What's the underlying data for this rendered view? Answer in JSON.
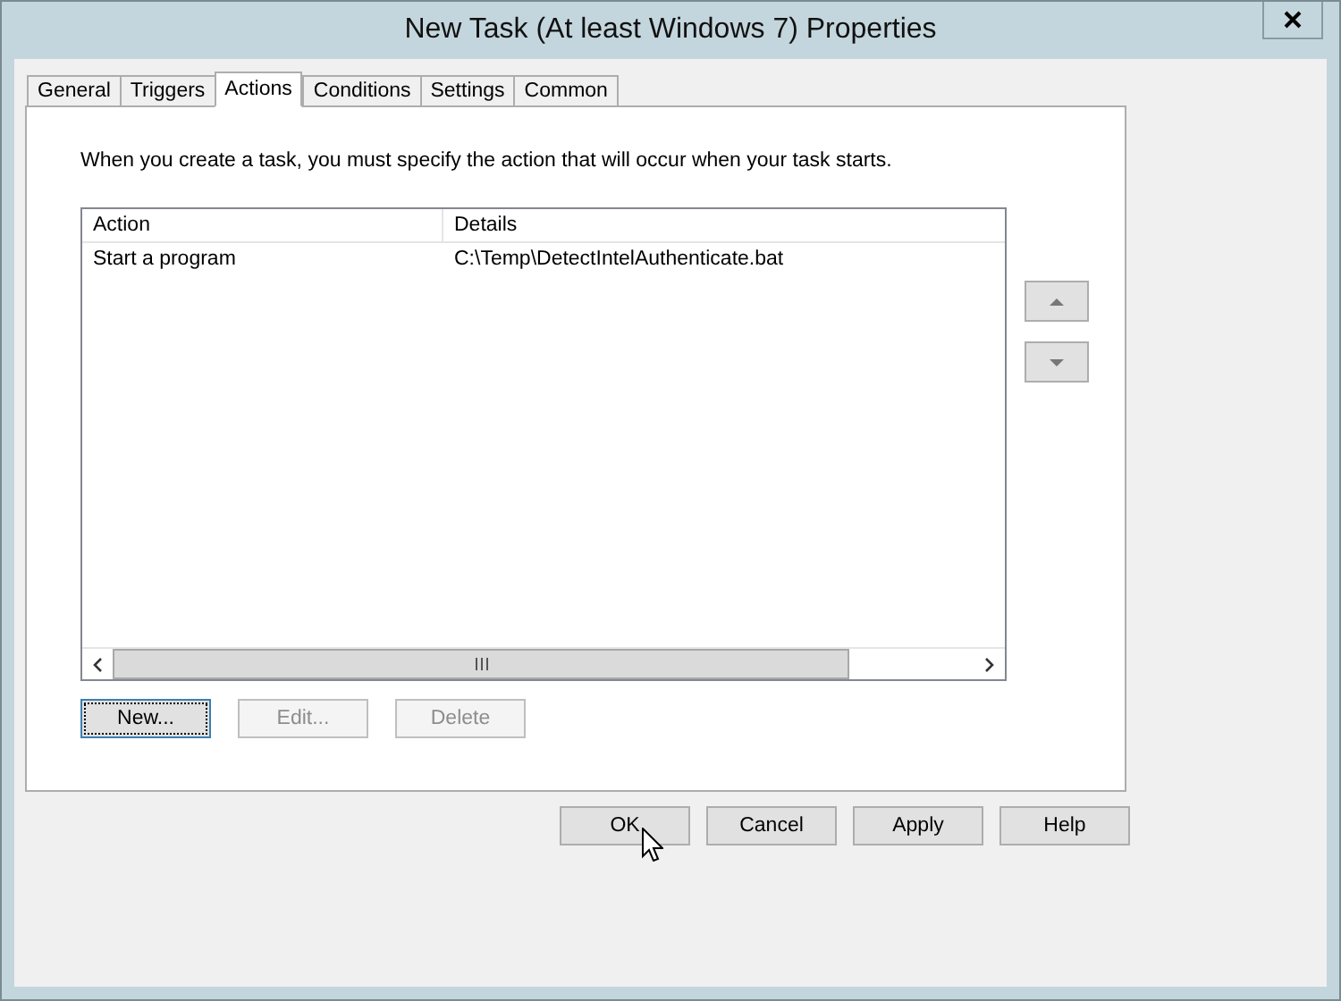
{
  "window": {
    "title": "New Task (At least Windows 7) Properties"
  },
  "tabs": [
    {
      "label": "General",
      "selected": false
    },
    {
      "label": "Triggers",
      "selected": false
    },
    {
      "label": "Actions",
      "selected": true
    },
    {
      "label": "Conditions",
      "selected": false
    },
    {
      "label": "Settings",
      "selected": false
    },
    {
      "label": "Common",
      "selected": false
    }
  ],
  "instruction": "When you create a task, you must specify the action that will occur when your task starts.",
  "table": {
    "columns": [
      "Action",
      "Details"
    ],
    "rows": [
      [
        "Start a program",
        "C:\\Temp\\DetectIntelAuthenticate.bat"
      ]
    ]
  },
  "action_buttons": [
    {
      "label": "New...",
      "disabled": false,
      "focused": true
    },
    {
      "label": "Edit...",
      "disabled": true,
      "focused": false
    },
    {
      "label": "Delete",
      "disabled": true,
      "focused": false
    }
  ],
  "dialog_buttons": [
    {
      "label": "OK"
    },
    {
      "label": "Cancel"
    },
    {
      "label": "Apply"
    },
    {
      "label": "Help"
    }
  ]
}
